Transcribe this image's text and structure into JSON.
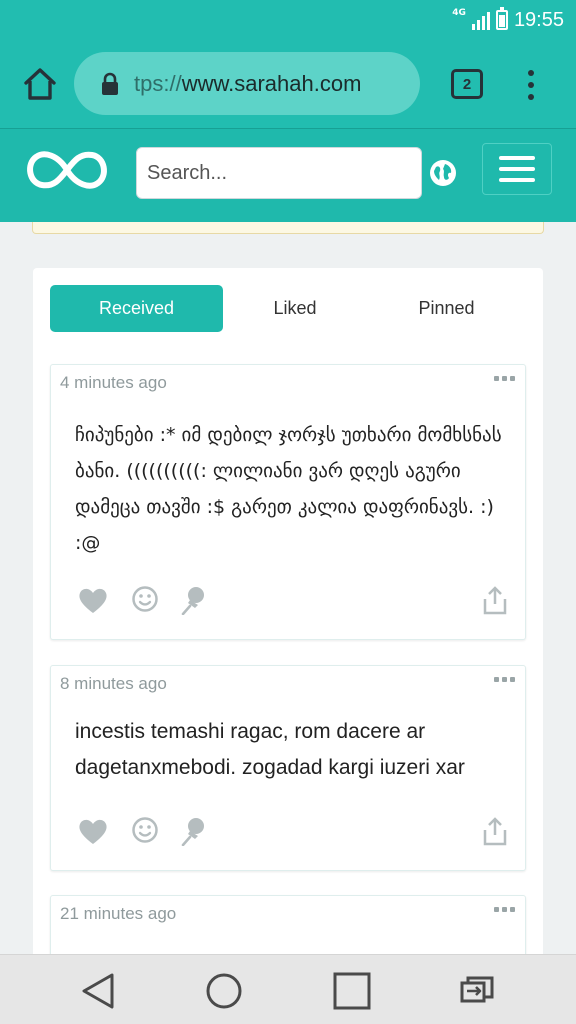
{
  "status_bar": {
    "network": "4G",
    "time": "19:55"
  },
  "browser": {
    "url_scheme": "tps://",
    "url_host": "www.sarahah.com",
    "tab_count": "2",
    "icons": [
      "home-icon",
      "lock-icon",
      "tab-switcher-icon",
      "overflow-menu-icon"
    ]
  },
  "header": {
    "search_placeholder": "Search...",
    "icons": [
      "infinity-logo",
      "globe-icon",
      "hamburger-menu-icon"
    ]
  },
  "tabs": [
    "Received",
    "Liked",
    "Pinned"
  ],
  "active_tab": "Received",
  "messages": [
    {
      "time": "4 minutes ago",
      "text": "ჩიპუნები :* იმ დებილ ჯორჯს უთხარი მომხსნას ბანი. ((((((((((: ლილიანი ვარ დღეს აგური დამეცა თავში :$ გარეთ კალია დაფრინავს. :) :@"
    },
    {
      "time": "8 minutes ago",
      "text": "incestis temashi ragac, rom dacere ar dagetanxmebodi. zogadad kargi iuzeri xar"
    },
    {
      "time": "21 minutes ago",
      "text": ""
    }
  ],
  "colors": {
    "teal": "#1fb9ac",
    "status_teal": "#22bdb0",
    "url_pill": "#5dd3c8",
    "icon_gray": "#b5bdbf"
  },
  "nav_bar": [
    "back-icon",
    "home-circle-icon",
    "recents-square-icon",
    "app-switch-icon"
  ]
}
